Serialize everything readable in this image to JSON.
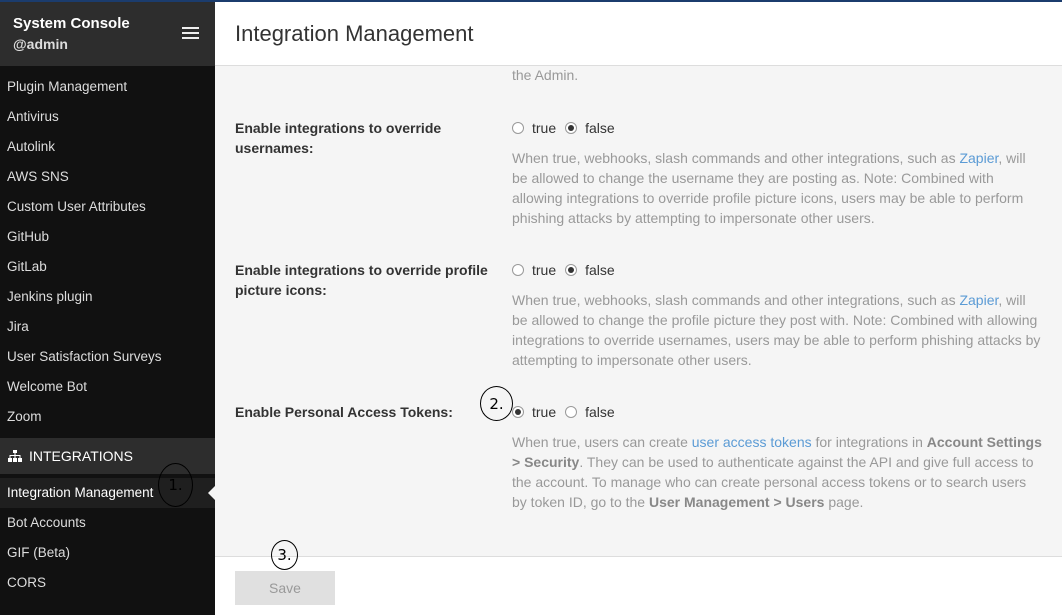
{
  "sidebar": {
    "title": "System Console",
    "user": "@admin",
    "plugin_items": [
      "Plugin Management",
      "Antivirus",
      "Autolink",
      "AWS SNS",
      "Custom User Attributes",
      "GitHub",
      "GitLab",
      "Jenkins plugin",
      "Jira",
      "User Satisfaction Surveys",
      "Welcome Bot",
      "Zoom"
    ],
    "section_header": "INTEGRATIONS",
    "integration_items": [
      "Integration Management",
      "Bot Accounts",
      "GIF (Beta)",
      "CORS"
    ]
  },
  "header": {
    "title": "Integration Management"
  },
  "content": {
    "cut_text": "the Admin.",
    "settings": [
      {
        "label": "Enable integrations to override usernames:",
        "true_label": "true",
        "false_label": "false",
        "selected": "false",
        "help_pre": "When true, webhooks, slash commands and other integrations, such as ",
        "help_link": "Zapier",
        "help_post": ", will be allowed to change the username they are posting as. Note: Combined with allowing integrations to override profile picture icons, users may be able to perform phishing attacks by attempting to impersonate other users."
      },
      {
        "label": "Enable integrations to override profile picture icons:",
        "true_label": "true",
        "false_label": "false",
        "selected": "false",
        "help_pre": "When true, webhooks, slash commands and other integrations, such as ",
        "help_link": "Zapier",
        "help_post": ", will be allowed to change the profile picture they post with. Note: Combined with allowing integrations to override usernames, users may be able to perform phishing attacks by attempting to impersonate other users."
      },
      {
        "label": "Enable Personal Access Tokens:",
        "true_label": "true",
        "false_label": "false",
        "selected": "true",
        "help_pre": "When true, users can create ",
        "help_link": "user access tokens",
        "help_mid1": " for integrations in ",
        "help_bold1": "Account Settings > Security",
        "help_mid2": ". They can be used to authenticate against the API and give full access to the account. To manage who can create personal access tokens or to search users by token ID, go to the ",
        "help_bold2": "User Management > Users",
        "help_post": " page."
      }
    ]
  },
  "footer": {
    "save_label": "Save"
  },
  "annotations": [
    "1.",
    "2.",
    "3."
  ],
  "colors": {
    "sidebar_bg": "#111111",
    "header_bg": "#2d2d2d",
    "link": "#5b9bd5",
    "accent_top": "#1b3c6d"
  }
}
